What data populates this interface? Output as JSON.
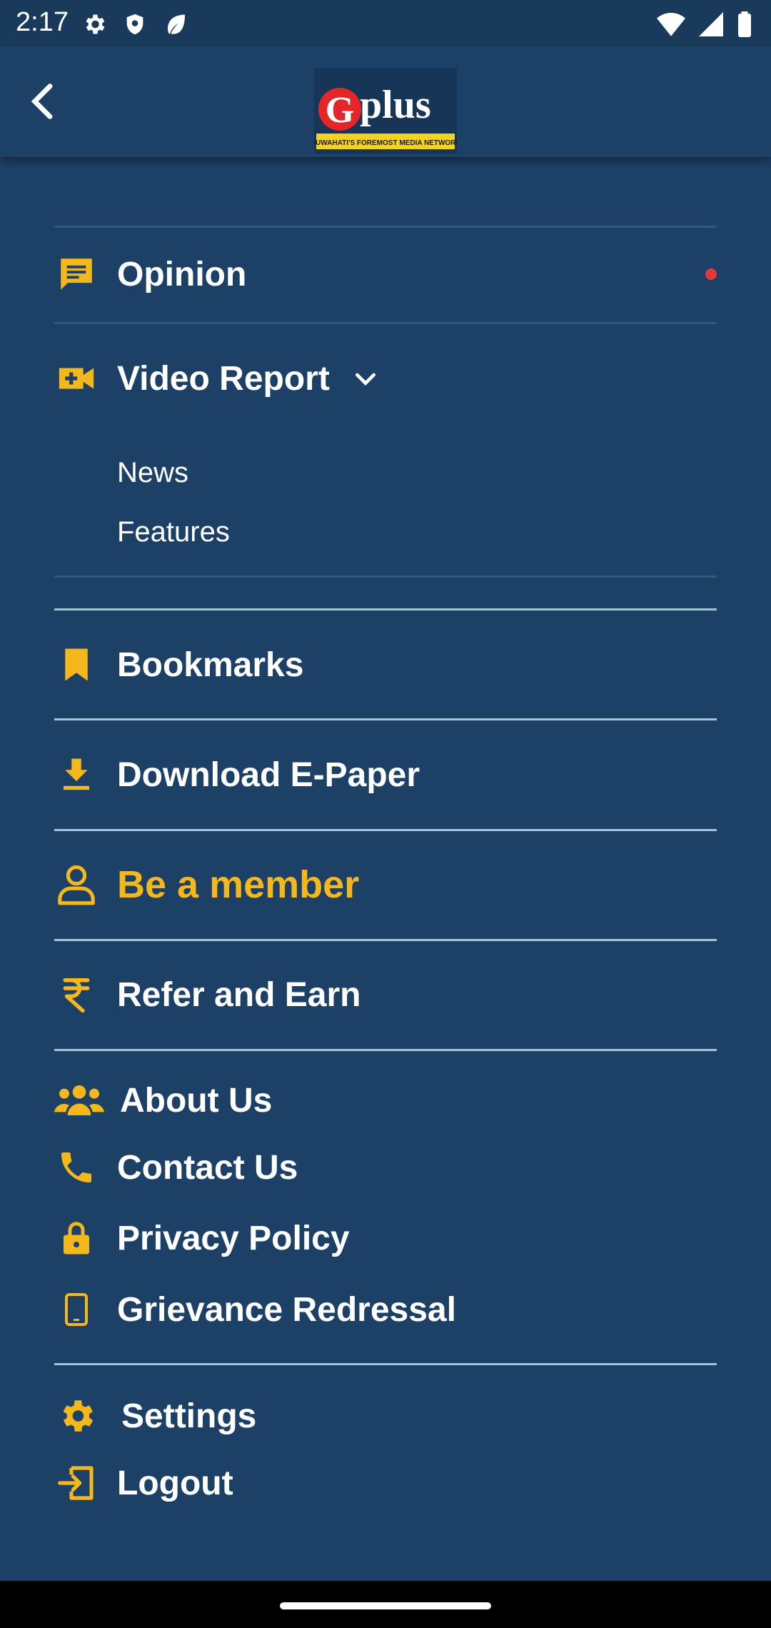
{
  "status_bar": {
    "time": "2:17"
  },
  "app_bar": {
    "logo_text": "plus",
    "logo_letter": "G",
    "logo_tagline": "GUWAHATI'S FOREMOST MEDIA NETWORK"
  },
  "menu": {
    "opinion": "Opinion",
    "video_report": "Video Report",
    "video_sub": [
      "News",
      "Features"
    ],
    "bookmarks": "Bookmarks",
    "download_epaper": "Download E-Paper",
    "be_member": "Be a member",
    "refer_earn": "Refer and Earn",
    "about_us": "About Us",
    "contact_us": "Contact Us",
    "privacy_policy": "Privacy Policy",
    "grievance": "Grievance Redressal",
    "settings": "Settings",
    "logout": "Logout"
  },
  "colors": {
    "background": "#1d4066",
    "accent": "#f5b81c",
    "notification_dot": "#e23a3a"
  }
}
